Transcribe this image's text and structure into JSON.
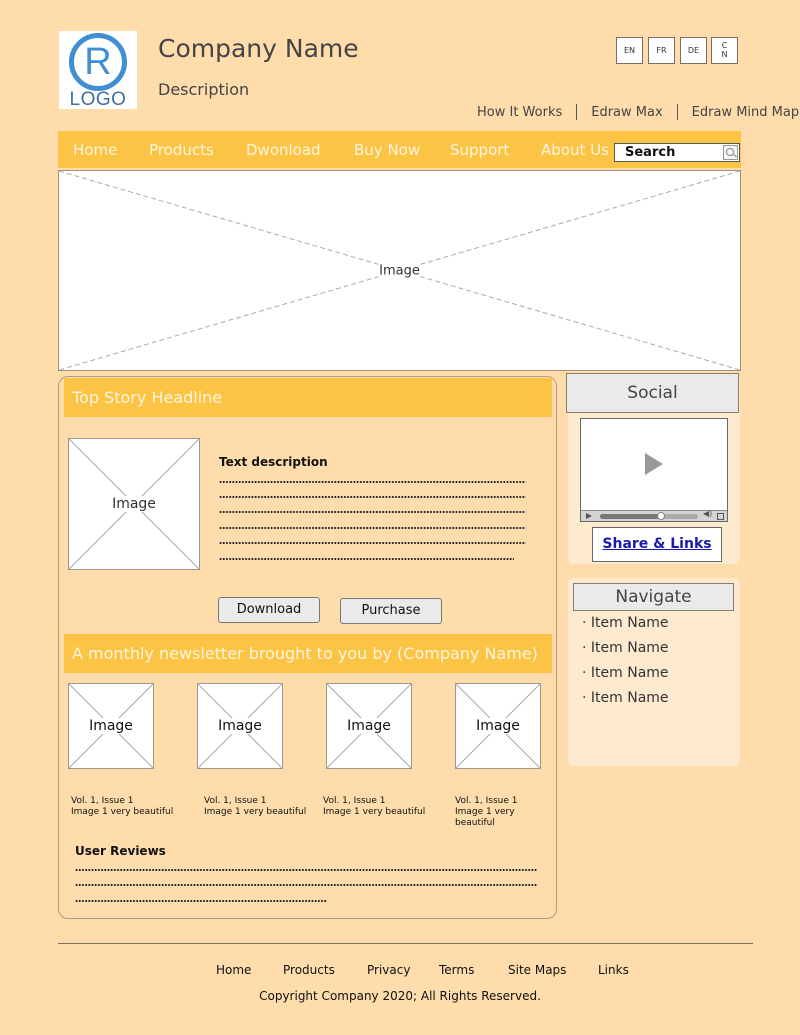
{
  "header": {
    "logo": {
      "glyph": "R",
      "text": "LOGO"
    },
    "company_name": "Company Name",
    "description": "Description",
    "languages": [
      "EN",
      "FR",
      "DE",
      "C\nN"
    ],
    "top_links": [
      "How It Works",
      "Edraw Max",
      "Edraw Mind Map"
    ]
  },
  "nav": {
    "items": [
      "Home",
      "Products",
      "Dwonload",
      "Buy Now",
      "Support",
      "About Us"
    ],
    "search_placeholder": "Search"
  },
  "banner": {
    "label": "Image"
  },
  "main": {
    "headline": "Top Story Headline",
    "story_image_label": "Image",
    "text_description": "Text description",
    "buttons": {
      "download": "Download",
      "purchase": "Purchase"
    },
    "newsletter_heading": "A monthly newsletter brought to you by (Company Name)",
    "issues": [
      {
        "image_label": "Image",
        "volume": "Vol. 1, Issue 1",
        "caption": "Image 1 very beautiful"
      },
      {
        "image_label": "Image",
        "volume": "Vol. 1, Issue 1",
        "caption": "Image 1 very beautiful"
      },
      {
        "image_label": "Image",
        "volume": "Vol. 1, Issue 1",
        "caption": "Image 1 very beautiful"
      },
      {
        "image_label": "Image",
        "volume": "Vol. 1, Issue 1",
        "caption": "Image 1 very beautiful"
      }
    ],
    "reviews_title": "User Reviews"
  },
  "sidebar": {
    "social_title": "Social",
    "video_progress": 0.62,
    "share_links": "Share & Links",
    "navigate_title": "Navigate",
    "nav_items": [
      "· Item Name",
      "· Item Name",
      "· Item Name",
      "· Item Name"
    ]
  },
  "footer": {
    "links": [
      "Home",
      "Products",
      "Privacy",
      "Terms",
      "Site Maps",
      "Links"
    ],
    "copyright": "Copyright Company 2020; All Rights Reserved."
  },
  "colors": {
    "background": "#fedcab",
    "accent": "#fcc444",
    "logo_blue": "#3f8fd2",
    "link_blue": "#1a1ab0"
  }
}
